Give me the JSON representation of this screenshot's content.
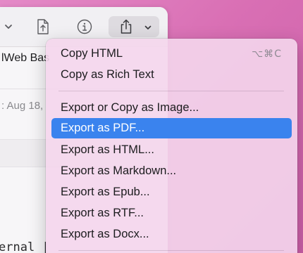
{
  "document": {
    "title_fragment": "lWeb Bas",
    "date_fragment": ": Aug 18,",
    "code_fragment": "ernal |"
  },
  "toolbar": {
    "icons": [
      "chevron-down-icon",
      "share-document-icon",
      "info-icon",
      "share-icon",
      "chevron-down-icon"
    ]
  },
  "menu": {
    "groups": [
      {
        "items": [
          {
            "label": "Copy HTML",
            "shortcut": "⌥⌘C"
          },
          {
            "label": "Copy as Rich Text"
          }
        ]
      },
      {
        "items": [
          {
            "label": "Export or Copy as Image..."
          },
          {
            "label": "Export as PDF...",
            "highlighted": true
          },
          {
            "label": "Export as HTML..."
          },
          {
            "label": "Export as Markdown..."
          },
          {
            "label": "Export as Epub..."
          },
          {
            "label": "Export as RTF..."
          },
          {
            "label": "Export as Docx..."
          }
        ]
      }
    ]
  },
  "colors": {
    "desktop": "#d96fb4",
    "menu_highlight": "#3a83ee",
    "menu_background": "#f4d6ec"
  }
}
